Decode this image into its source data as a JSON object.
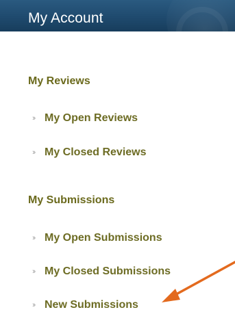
{
  "header": {
    "title": "My Account"
  },
  "sections": [
    {
      "title": "My Reviews",
      "items": [
        {
          "label": "My Open Reviews"
        },
        {
          "label": "My Closed Reviews"
        }
      ]
    },
    {
      "title": "My Submissions",
      "items": [
        {
          "label": "My Open Submissions"
        },
        {
          "label": "My Closed Submissions"
        },
        {
          "label": "New Submissions"
        }
      ]
    }
  ],
  "icons": {
    "bullet": "double-arrow-icon",
    "annotation": "orange-pointer-arrow-icon"
  },
  "colors": {
    "header_bg": "#1f4a6e",
    "section_title": "#6b6a1d",
    "item_text": "#6d6c24",
    "annotation_arrow": "#e36a1e"
  }
}
